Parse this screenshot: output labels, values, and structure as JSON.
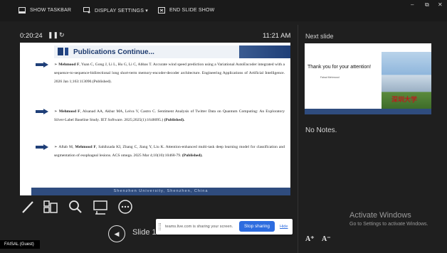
{
  "toolbar": {
    "show_taskbar": "SHOW TASKBAR",
    "display_settings": "DISPLAY SETTINGS ▾",
    "end_slide_show": "END SLIDE SHOW"
  },
  "window_controls": {
    "minimize": "–",
    "restore": "⧉",
    "close": "✕"
  },
  "timer": {
    "elapsed": "0:20:24",
    "clock": "11:21 AM"
  },
  "slide": {
    "title": "Publications Continue...",
    "entries": [
      {
        "text_pre": "➢ ",
        "bold": "Mehmood F",
        "text": ", Yuan C, Gong J, Li L, Hu G, Li C, Abbas T. Accurate wind speed prediction using a Variational AutoEncoder integrated with a sequence-to-sequence-bidirectional long short-term memory-encoder-decoder architecture. Engineering Applications of Artificial Intelligence. 2026 Jan 1;163:113090.(Published)."
      },
      {
        "text_pre": "➢ ",
        "bold": "Mehmood F",
        "text": ", Alsanad AA, Akbar MA, Leiva V, Castro C. Sentiment Analysis of Twitter Data on Quantum Computing: An Exploratory Silver-Label Baseline Study. IET Software. 2025;2025(1):1648095.) ",
        "bold_tail": "(Published)."
      },
      {
        "text_pre": "➢ Aftab M, ",
        "bold": "Mehmood F",
        "text": ", Sahibzada KI, Zhang C, Jiang Y, Liu K. Attention-enhanced multi-task deep learning model for classification and segmentation of esophageal lesions. ACS omega. 2025 Mar 4;10(10):10468-79. ",
        "bold_tail": "(Published)."
      }
    ],
    "footer": "Shenzhen University, Shenzhen, China"
  },
  "next_slide": {
    "label": "Next slide",
    "thanks": "Thank you for your attention!",
    "name": "Faisal Mehmood",
    "seal": "深圳大学"
  },
  "notes": "No Notes.",
  "slide_number": "Slide 18",
  "sharing": {
    "message": "teams.live.com is sharing your screen.",
    "stop": "Stop sharing",
    "hide": "Hide"
  },
  "activate": {
    "title": "Activate Windows",
    "subtitle": "Go to Settings to activate Windows."
  },
  "font_controls": {
    "increase": "A⁺",
    "decrease": "A⁻"
  },
  "user": "FAISAL (Guest)",
  "colors": {
    "accent": "#2d6cdf",
    "slide_navy": "#1f3f78",
    "background": "#1f1f1f"
  }
}
